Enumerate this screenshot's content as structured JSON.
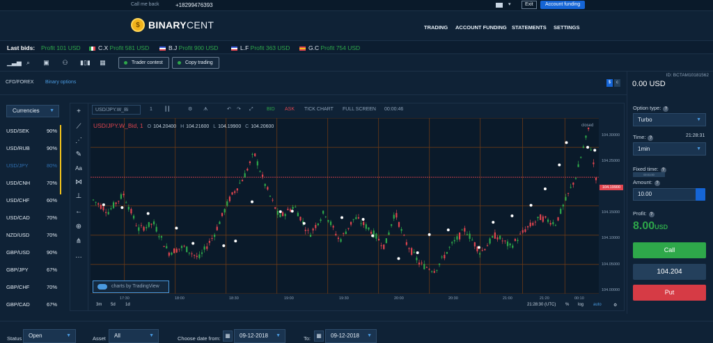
{
  "topbar": {
    "call_me_back": "Call me back",
    "phone": "+18299476393",
    "exit": "Exit",
    "account_funding_button": "Account funding"
  },
  "brand": {
    "name": "BINARYCENT",
    "name_strong": "BINARY",
    "name_light": "CENT"
  },
  "nav": [
    "TRADING",
    "ACCOUNT FUNDING",
    "STATEMENTS",
    "SETTINGS"
  ],
  "ticker": {
    "label": "Last bids:",
    "items": [
      {
        "name": "",
        "profit": "Profit 101 USD",
        "flag_colors": []
      },
      {
        "name": "C.X",
        "profit": "Profit 581 USD",
        "flag_colors": [
          "#2ea84a",
          "#ffffff",
          "#e0454f"
        ]
      },
      {
        "name": "B.J",
        "profit": "Profit 900 USD",
        "flag_colors": [
          "#3b5bdb",
          "#ffffff",
          "#e0454f"
        ]
      },
      {
        "name": "L.F",
        "profit": "Profit 363 USD",
        "flag_colors": [
          "#3b5bdb",
          "#ffffff",
          "#e0454f"
        ]
      },
      {
        "name": "G.C",
        "profit": "Profit 754 USD",
        "flag_colors": [
          "#e0454f",
          "#f2c21b",
          "#e0454f"
        ]
      }
    ]
  },
  "toolbar": {
    "trader_contest": "Trader contest",
    "copy_trading": "Copy trading"
  },
  "tabs": {
    "cfd": "CFD/FOREX",
    "binary": "Binary options"
  },
  "account": {
    "id": "ID: BCTAM10181562",
    "balance": "0.00 USD",
    "currency_dollar": "$",
    "currency_cent": "c"
  },
  "assets": {
    "filter": "Currencies",
    "list": [
      {
        "name": "USD/SEK",
        "pct": "90%",
        "dim": false
      },
      {
        "name": "USD/RUB",
        "pct": "90%",
        "dim": false
      },
      {
        "name": "USD/JPY",
        "pct": "80%",
        "dim": true
      },
      {
        "name": "USD/CNH",
        "pct": "70%",
        "dim": false
      },
      {
        "name": "USD/CHF",
        "pct": "60%",
        "dim": false
      },
      {
        "name": "USD/CAD",
        "pct": "70%",
        "dim": false
      },
      {
        "name": "NZD/USD",
        "pct": "70%",
        "dim": false
      },
      {
        "name": "GBP/USD",
        "pct": "90%",
        "dim": false
      },
      {
        "name": "GBP/JPY",
        "pct": "67%",
        "dim": false
      },
      {
        "name": "GBP/CHF",
        "pct": "70%",
        "dim": false
      },
      {
        "name": "GBP/CAD",
        "pct": "67%",
        "dim": false
      }
    ]
  },
  "chart_toolbar": {
    "symbol": "USD/JPY.W_Bi",
    "interval": "1",
    "bid": "BID",
    "ask": "ASK",
    "tick_chart": "TICK CHART",
    "full_screen": "FULL SCREEN",
    "timer": "00:00:46"
  },
  "chart_data": {
    "type": "candlestick",
    "symbol_label": "USD/JPY.W_Bid, 1",
    "ohlc": {
      "o_label": "O",
      "o": "104.20400",
      "h_label": "H",
      "h": "104.21600",
      "l_label": "L",
      "l": "104.19900",
      "c_label": "C",
      "c": "104.20600"
    },
    "status": "closed",
    "ylim": [
      104.0,
      104.3
    ],
    "y_ticks": [
      "104.30000",
      "104.25000",
      "104.15000",
      "104.10000",
      "104.05000",
      "104.00000"
    ],
    "last_price_label": "104.19900",
    "last_price": 104.199,
    "x_ticks": [
      "17:30",
      "18:00",
      "18:30",
      "19:00",
      "19:30",
      "20:00",
      "20:30",
      "21:00",
      "21:20",
      "00:10"
    ],
    "x_tick_positions": [
      0.0667,
      0.1667,
      0.2667,
      0.3667,
      0.4667,
      0.5667,
      0.6667,
      0.7667,
      0.85,
      0.9333
    ],
    "close_path": [
      [
        0.0,
        104.16
      ],
      [
        0.03,
        104.14
      ],
      [
        0.06,
        104.17
      ],
      [
        0.09,
        104.11
      ],
      [
        0.12,
        104.12
      ],
      [
        0.15,
        104.07
      ],
      [
        0.18,
        104.08
      ],
      [
        0.21,
        104.06
      ],
      [
        0.24,
        104.1
      ],
      [
        0.27,
        104.16
      ],
      [
        0.3,
        104.2
      ],
      [
        0.32,
        104.24
      ],
      [
        0.34,
        104.19
      ],
      [
        0.37,
        104.13
      ],
      [
        0.4,
        104.15
      ],
      [
        0.43,
        104.1
      ],
      [
        0.46,
        104.14
      ],
      [
        0.49,
        104.09
      ],
      [
        0.52,
        104.13
      ],
      [
        0.55,
        104.11
      ],
      [
        0.58,
        104.08
      ],
      [
        0.6,
        104.14
      ],
      [
        0.62,
        104.09
      ],
      [
        0.65,
        104.05
      ],
      [
        0.68,
        104.04
      ],
      [
        0.71,
        104.08
      ],
      [
        0.74,
        104.11
      ],
      [
        0.77,
        104.07
      ],
      [
        0.8,
        104.1
      ],
      [
        0.83,
        104.08
      ],
      [
        0.86,
        104.11
      ],
      [
        0.89,
        104.13
      ],
      [
        0.92,
        104.12
      ],
      [
        0.94,
        104.16
      ],
      [
        0.96,
        104.2
      ],
      [
        0.975,
        104.25
      ],
      [
        0.985,
        104.28
      ],
      [
        0.993,
        104.23
      ],
      [
        1.0,
        104.199
      ]
    ],
    "markers": [
      [
        0.016,
        104.152
      ],
      [
        0.055,
        104.147
      ],
      [
        0.11,
        104.137
      ],
      [
        0.17,
        104.112
      ],
      [
        0.205,
        104.086
      ],
      [
        0.27,
        104.082
      ],
      [
        0.295,
        104.09
      ],
      [
        0.33,
        104.157
      ],
      [
        0.39,
        104.14
      ],
      [
        0.415,
        104.141
      ],
      [
        0.44,
        104.12
      ],
      [
        0.52,
        104.13
      ],
      [
        0.565,
        104.127
      ],
      [
        0.585,
        104.099
      ],
      [
        0.64,
        104.06
      ],
      [
        0.68,
        104.07
      ],
      [
        0.705,
        104.101
      ],
      [
        0.745,
        104.109
      ],
      [
        0.81,
        104.079
      ],
      [
        0.84,
        104.122
      ],
      [
        0.88,
        104.133
      ],
      [
        0.92,
        104.151
      ],
      [
        0.95,
        104.179
      ],
      [
        0.98,
        104.22
      ],
      [
        0.995,
        104.258
      ],
      [
        1.04,
        104.25
      ],
      [
        1.055,
        104.245
      ]
    ],
    "timestamp": "21:28:30 (UTC)",
    "periods": [
      "3m",
      "5d",
      "1d"
    ],
    "scale_options": [
      "%",
      "log",
      "auto"
    ],
    "watermark": "charts by TradingView",
    "watermark_brand": "TradingView"
  },
  "order": {
    "option_type_label": "Option type:",
    "option_type": "Turbo",
    "time_label": "Time:",
    "clock": "21:28:31",
    "time_value": "1min",
    "fixed_time_label": "Fixed time:",
    "fixed_time_info": "00:01:00",
    "amount_label": "Amount:",
    "amount": "10.00",
    "profit_label": "Profit:",
    "profit_value": "8.00",
    "profit_currency": "USD",
    "call": "Call",
    "price": "104.204",
    "put": "Put"
  },
  "footer": {
    "status_label": "Status",
    "status_value": "Open",
    "asset_label": "Asset",
    "asset_value": "All",
    "from_label": "Choose date from:",
    "from_value": "09-12-2018",
    "to_label": "To:",
    "to_value": "09-12-2018"
  },
  "colors": {
    "bull": "#2ea84a",
    "bear": "#e0454f",
    "grid": "#6b3a16",
    "accent": "#1565d6"
  }
}
